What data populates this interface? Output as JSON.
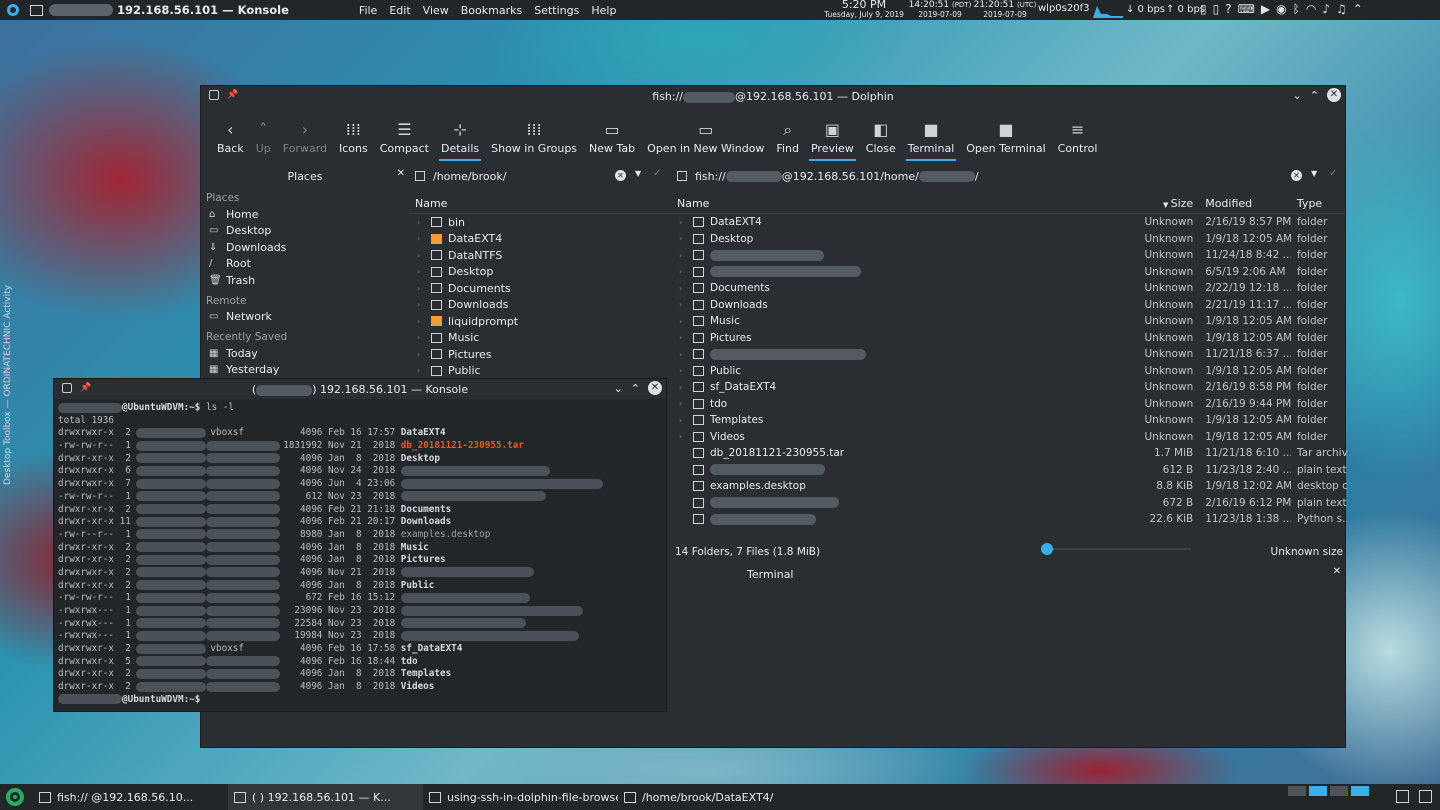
{
  "top_panel": {
    "window_title": "192.168.56.101 — Konsole",
    "menus": [
      "File",
      "Edit",
      "View",
      "Bookmarks",
      "Settings",
      "Help"
    ],
    "clock_time": "5:20 PM",
    "clock_date": "Tuesday, July 9, 2019",
    "tz1_time": "14:20:51",
    "tz1_zone": "(PDT)",
    "tz1_date": "2019-07-09",
    "tz2_time": "21:20:51",
    "tz2_zone": "(UTC)",
    "tz2_date": "2019-07-09",
    "net_iface": "wlp0s20f3",
    "down_rate": "↓ 0 bps",
    "up_rate": "↑ 0 bps"
  },
  "side_label": "Desktop Toolbox — ORDINATECHNIC Activity",
  "dolphin": {
    "title_prefix": "fish://",
    "title_suffix": "@192.168.56.101 — Dolphin",
    "toolbar": [
      {
        "label": "Back",
        "icon": "‹",
        "disabled": false
      },
      {
        "label": "Up",
        "icon": "˄",
        "disabled": true
      },
      {
        "label": "Forward",
        "icon": "›",
        "disabled": true
      },
      {
        "label": "Icons",
        "icon": "⁞⁞⁞",
        "disabled": false
      },
      {
        "label": "Compact",
        "icon": "☰",
        "disabled": false
      },
      {
        "label": "Details",
        "icon": "⊹",
        "disabled": false,
        "active": true
      },
      {
        "label": "Show in Groups",
        "icon": "⁞⁞⁞",
        "disabled": false
      },
      {
        "label": "New Tab",
        "icon": "▭",
        "disabled": false
      },
      {
        "label": "Open in New Window",
        "icon": "▭",
        "disabled": false
      },
      {
        "label": "Find",
        "icon": "⌕",
        "disabled": false
      },
      {
        "label": "Preview",
        "icon": "▣",
        "disabled": false,
        "active": true
      },
      {
        "label": "Close",
        "icon": "◧",
        "disabled": false
      },
      {
        "label": "Terminal",
        "icon": "■",
        "disabled": false,
        "active": true
      },
      {
        "label": "Open Terminal",
        "icon": "■",
        "disabled": false
      },
      {
        "label": "Control",
        "icon": "≡",
        "disabled": false
      }
    ],
    "places": {
      "header": "Places",
      "sections": [
        {
          "title": "Places",
          "items": [
            {
              "label": "Home",
              "icon": "⌂"
            },
            {
              "label": "Desktop",
              "icon": "▭"
            },
            {
              "label": "Downloads",
              "icon": "⇓"
            },
            {
              "label": "Root",
              "icon": "/"
            },
            {
              "label": "Trash",
              "icon": "🗑"
            }
          ]
        },
        {
          "title": "Remote",
          "items": [
            {
              "label": "Network",
              "icon": "▭"
            }
          ]
        },
        {
          "title": "Recently Saved",
          "items": [
            {
              "label": "Today",
              "icon": "▦"
            },
            {
              "label": "Yesterday",
              "icon": "▦"
            }
          ]
        }
      ]
    },
    "left_pane": {
      "path": "/home/brook/",
      "column": "Name",
      "rows": [
        "bin",
        "DataEXT4",
        "DataNTFS",
        "Desktop",
        "Documents",
        "Downloads",
        "liquidprompt",
        "Music",
        "Pictures",
        "Public"
      ]
    },
    "right_pane": {
      "path_prefix": "fish://",
      "path_mid": "@192.168.56.101/home/",
      "path_suffix": "/",
      "columns": {
        "name": "Name",
        "size": "Size",
        "modified": "Modified",
        "type": "Type"
      },
      "rows": [
        {
          "name": "DataEXT4",
          "size": "Unknown",
          "modified": "2/16/19 8:57 PM",
          "type": "folder",
          "blur": false
        },
        {
          "name": "Desktop",
          "size": "Unknown",
          "modified": "1/9/18 12:05 AM",
          "type": "folder",
          "blur": false
        },
        {
          "name": "",
          "size": "Unknown",
          "modified": "11/24/18 8:42 ...",
          "type": "folder",
          "blur": true
        },
        {
          "name": "",
          "size": "Unknown",
          "modified": "6/5/19 2:06 AM",
          "type": "folder",
          "blur": true
        },
        {
          "name": "Documents",
          "size": "Unknown",
          "modified": "2/22/19 12:18 ...",
          "type": "folder",
          "blur": false
        },
        {
          "name": "Downloads",
          "size": "Unknown",
          "modified": "2/21/19 11:17 ...",
          "type": "folder",
          "blur": false
        },
        {
          "name": "Music",
          "size": "Unknown",
          "modified": "1/9/18 12:05 AM",
          "type": "folder",
          "blur": false
        },
        {
          "name": "Pictures",
          "size": "Unknown",
          "modified": "1/9/18 12:05 AM",
          "type": "folder",
          "blur": false
        },
        {
          "name": "",
          "size": "Unknown",
          "modified": "11/21/18 6:37 ...",
          "type": "folder",
          "blur": true
        },
        {
          "name": "Public",
          "size": "Unknown",
          "modified": "1/9/18 12:05 AM",
          "type": "folder",
          "blur": false
        },
        {
          "name": "sf_DataEXT4",
          "size": "Unknown",
          "modified": "2/16/19 8:58 PM",
          "type": "folder",
          "blur": false
        },
        {
          "name": "tdo",
          "size": "Unknown",
          "modified": "2/16/19 9:44 PM",
          "type": "folder",
          "blur": false
        },
        {
          "name": "Templates",
          "size": "Unknown",
          "modified": "1/9/18 12:05 AM",
          "type": "folder",
          "blur": false
        },
        {
          "name": "Videos",
          "size": "Unknown",
          "modified": "1/9/18 12:05 AM",
          "type": "folder",
          "blur": false
        },
        {
          "name": "db_20181121-230955.tar",
          "size": "1.7 MiB",
          "modified": "11/21/18 6:10 ...",
          "type": "Tar archive",
          "blur": false
        },
        {
          "name": "",
          "size": "612 B",
          "modified": "11/23/18 2:40 ...",
          "type": "plain text...",
          "blur": true
        },
        {
          "name": "examples.desktop",
          "size": "8.8 KiB",
          "modified": "1/9/18 12:02 AM",
          "type": "desktop c...",
          "blur": false
        },
        {
          "name": "",
          "size": "672 B",
          "modified": "2/16/19 6:12 PM",
          "type": "plain text...",
          "blur": true
        },
        {
          "name": "",
          "size": "22.6 KiB",
          "modified": "11/23/18 1:38 ...",
          "type": "Python s...",
          "blur": true
        }
      ]
    },
    "status": "14 Folders, 7 Files (1.8 MiB)",
    "status_size": "Unknown size",
    "terminal_panel": "Terminal"
  },
  "konsole": {
    "title": "192.168.56.101 — Konsole",
    "prompt_host": "@UbuntuWDVM:~$",
    "command": " ls -l",
    "total": "total 1936",
    "lines": [
      {
        "perm": "drwxrwxr-x",
        "n": " 2",
        "grp": "vboxsf",
        "size": "4096",
        "date": "Feb 16 17:57",
        "name": "DataEXT4",
        "cls": "kb"
      },
      {
        "perm": "-rw-rw-r--",
        "n": " 1",
        "grp": "",
        "size": "1831992",
        "date": "Nov 21  2018",
        "name": "db_20181121-230955.tar",
        "cls": "kr"
      },
      {
        "perm": "drwxr-xr-x",
        "n": " 2",
        "grp": "",
        "size": "4096",
        "date": "Jan  8  2018",
        "name": "Desktop",
        "cls": "kb"
      },
      {
        "perm": "drwxrwxr-x",
        "n": " 6",
        "grp": "",
        "size": "4096",
        "date": "Nov 24  2018",
        "name": "",
        "cls": "kb"
      },
      {
        "perm": "drwxrwxr-x",
        "n": " 7",
        "grp": "",
        "size": "4096",
        "date": "Jun  4 23:06",
        "name": "",
        "cls": "kb"
      },
      {
        "perm": "-rw-rw-r--",
        "n": " 1",
        "grp": "",
        "size": "612",
        "date": "Nov 23  2018",
        "name": "",
        "cls": "kg"
      },
      {
        "perm": "drwxr-xr-x",
        "n": " 2",
        "grp": "",
        "size": "4096",
        "date": "Feb 21 21:18",
        "name": "Documents",
        "cls": "kb"
      },
      {
        "perm": "drwxr-xr-x",
        "n": "11",
        "grp": "",
        "size": "4096",
        "date": "Feb 21 20:17",
        "name": "Downloads",
        "cls": "kb"
      },
      {
        "perm": "-rw-r--r--",
        "n": " 1",
        "grp": "",
        "size": "8980",
        "date": "Jan  8  2018",
        "name": "examples.desktop",
        "cls": "kg"
      },
      {
        "perm": "drwxr-xr-x",
        "n": " 2",
        "grp": "",
        "size": "4096",
        "date": "Jan  8  2018",
        "name": "Music",
        "cls": "kb"
      },
      {
        "perm": "drwxr-xr-x",
        "n": " 2",
        "grp": "",
        "size": "4096",
        "date": "Jan  8  2018",
        "name": "Pictures",
        "cls": "kb"
      },
      {
        "perm": "drwxrwxr-x",
        "n": " 2",
        "grp": "",
        "size": "4096",
        "date": "Nov 21  2018",
        "name": "",
        "cls": "kb"
      },
      {
        "perm": "drwxr-xr-x",
        "n": " 2",
        "grp": "",
        "size": "4096",
        "date": "Jan  8  2018",
        "name": "Public",
        "cls": "kb"
      },
      {
        "perm": "-rw-rw-r--",
        "n": " 1",
        "grp": "",
        "size": "672",
        "date": "Feb 16 15:12",
        "name": "",
        "cls": "kg"
      },
      {
        "perm": "-rwxrwx---",
        "n": " 1",
        "grp": "",
        "size": "23096",
        "date": "Nov 23  2018",
        "name": "",
        "cls": "kg"
      },
      {
        "perm": "-rwxrwx---",
        "n": " 1",
        "grp": "",
        "size": "22584",
        "date": "Nov 23  2018",
        "name": "",
        "cls": "kg"
      },
      {
        "perm": "-rwxrwx---",
        "n": " 1",
        "grp": "",
        "size": "19984",
        "date": "Nov 23  2018",
        "name": "",
        "cls": "kg"
      },
      {
        "perm": "drwxrwxr-x",
        "n": " 2",
        "grp": "vboxsf",
        "size": "4096",
        "date": "Feb 16 17:58",
        "name": "sf_DataEXT4",
        "cls": "kb"
      },
      {
        "perm": "drwxrwxr-x",
        "n": " 5",
        "grp": "",
        "size": "4096",
        "date": "Feb 16 18:44",
        "name": "tdo",
        "cls": "kb"
      },
      {
        "perm": "drwxr-xr-x",
        "n": " 2",
        "grp": "",
        "size": "4096",
        "date": "Jan  8  2018",
        "name": "Templates",
        "cls": "kb"
      },
      {
        "perm": "drwxr-xr-x",
        "n": " 2",
        "grp": "",
        "size": "4096",
        "date": "Jan  8  2018",
        "name": "Videos",
        "cls": "kb"
      }
    ]
  },
  "taskbar": {
    "tasks": [
      {
        "label": "fish://          @192.168.56.10...",
        "active": false
      },
      {
        "label": "(          ) 192.168.56.101 — K...",
        "active": true
      },
      {
        "label": "using-ssh-in-dolphin-file-browser_...",
        "active": false
      },
      {
        "label": "/home/brook/DataEXT4/",
        "active": false
      }
    ]
  },
  "colors": {
    "accent": "#3daee9",
    "panel": "#232629",
    "window": "#2a2e32",
    "tar": "#e05a2b"
  }
}
